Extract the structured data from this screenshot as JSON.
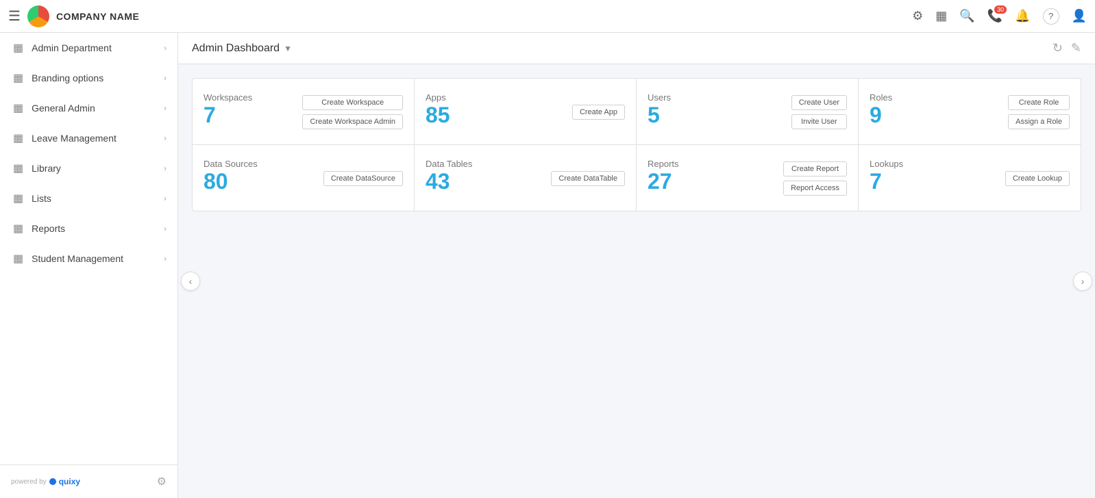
{
  "topnav": {
    "company_name": "COMPANY NAME",
    "hamburger_icon": "☰",
    "icons": {
      "settings": "⚙",
      "layout": "▦",
      "search": "🔍",
      "calls": "📞",
      "calls_badge": "30",
      "bell": "🔔",
      "help": "?",
      "user": "👤"
    }
  },
  "sidebar": {
    "items": [
      {
        "label": "Admin Department",
        "icon": "▦"
      },
      {
        "label": "Branding options",
        "icon": "▦"
      },
      {
        "label": "General Admin",
        "icon": "▦"
      },
      {
        "label": "Leave Management",
        "icon": "▦"
      },
      {
        "label": "Library",
        "icon": "▦"
      },
      {
        "label": "Lists",
        "icon": "▦"
      },
      {
        "label": "Reports",
        "icon": "▦"
      },
      {
        "label": "Student Management",
        "icon": "▦"
      }
    ],
    "footer": {
      "powered_by": "powered by",
      "logo_text": "quixy",
      "settings_icon": "⚙"
    }
  },
  "header": {
    "title": "Admin Dashboard",
    "dropdown_icon": "▼",
    "refresh_icon": "↻",
    "edit_icon": "✎"
  },
  "dashboard": {
    "cards_row1": [
      {
        "label": "Workspaces",
        "number": "7",
        "actions": [
          "Create Workspace",
          "Create Workspace Admin"
        ]
      },
      {
        "label": "Apps",
        "number": "85",
        "actions": [
          "Create App"
        ]
      },
      {
        "label": "Users",
        "number": "5",
        "actions": [
          "Create User",
          "Invite User"
        ]
      },
      {
        "label": "Roles",
        "number": "9",
        "actions": [
          "Create Role",
          "Assign a Role"
        ]
      }
    ],
    "cards_row2": [
      {
        "label": "Data Sources",
        "number": "80",
        "actions": [
          "Create DataSource"
        ]
      },
      {
        "label": "Data Tables",
        "number": "43",
        "actions": [
          "Create DataTable"
        ]
      },
      {
        "label": "Reports",
        "number": "27",
        "actions": [
          "Create Report",
          "Report Access"
        ]
      },
      {
        "label": "Lookups",
        "number": "7",
        "actions": [
          "Create Lookup"
        ]
      }
    ]
  }
}
